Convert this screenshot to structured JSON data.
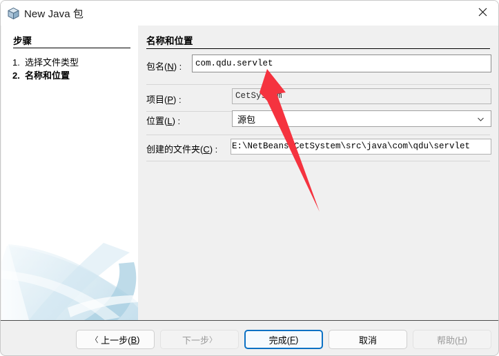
{
  "window": {
    "title": "New Java 包",
    "icon": "java-package-cube-icon",
    "close_label": "×"
  },
  "sidebar": {
    "heading": "步骤",
    "steps": [
      {
        "num": "1.",
        "label": "选择文件类型",
        "current": false
      },
      {
        "num": "2.",
        "label": "名称和位置",
        "current": true
      }
    ]
  },
  "main": {
    "heading": "名称和位置",
    "fields": [
      {
        "label": "包名(",
        "mnemonic": "N",
        "label_end": ") :",
        "value": "com.qdu.servlet",
        "type": "text"
      },
      {
        "label": "项目(",
        "mnemonic": "P",
        "label_end": ") :",
        "value": "CetSystem",
        "type": "text-disabled"
      },
      {
        "label": "位置(",
        "mnemonic": "L",
        "label_end": ") :",
        "value": "源包",
        "type": "combobox"
      },
      {
        "label": "创建的文件夹(",
        "mnemonic": "C",
        "label_end": ") :",
        "value": "E:\\NetBeans\\CetSystem\\src\\java\\com\\qdu\\servlet",
        "type": "text"
      }
    ]
  },
  "footer": {
    "buttons": [
      {
        "name": "back",
        "prefix": "〈",
        "text": "上一步(",
        "mnemonic": "B",
        "suffix": ")",
        "state": "enabled"
      },
      {
        "name": "next",
        "prefix": "",
        "text": "下一步 ",
        "mnemonic": "",
        "suffix": "〉",
        "state": "disabled"
      },
      {
        "name": "finish",
        "prefix": "",
        "text": "完成(",
        "mnemonic": "F",
        "suffix": ")",
        "state": "default"
      },
      {
        "name": "cancel",
        "prefix": "",
        "text": "取消",
        "mnemonic": "",
        "suffix": "",
        "state": "enabled"
      },
      {
        "name": "help",
        "prefix": "",
        "text": "帮助(",
        "mnemonic": "H",
        "suffix": ")",
        "state": "disabled"
      }
    ]
  },
  "annotation": {
    "type": "arrow",
    "color": "#f5333f",
    "points_to": "package-name-input"
  }
}
